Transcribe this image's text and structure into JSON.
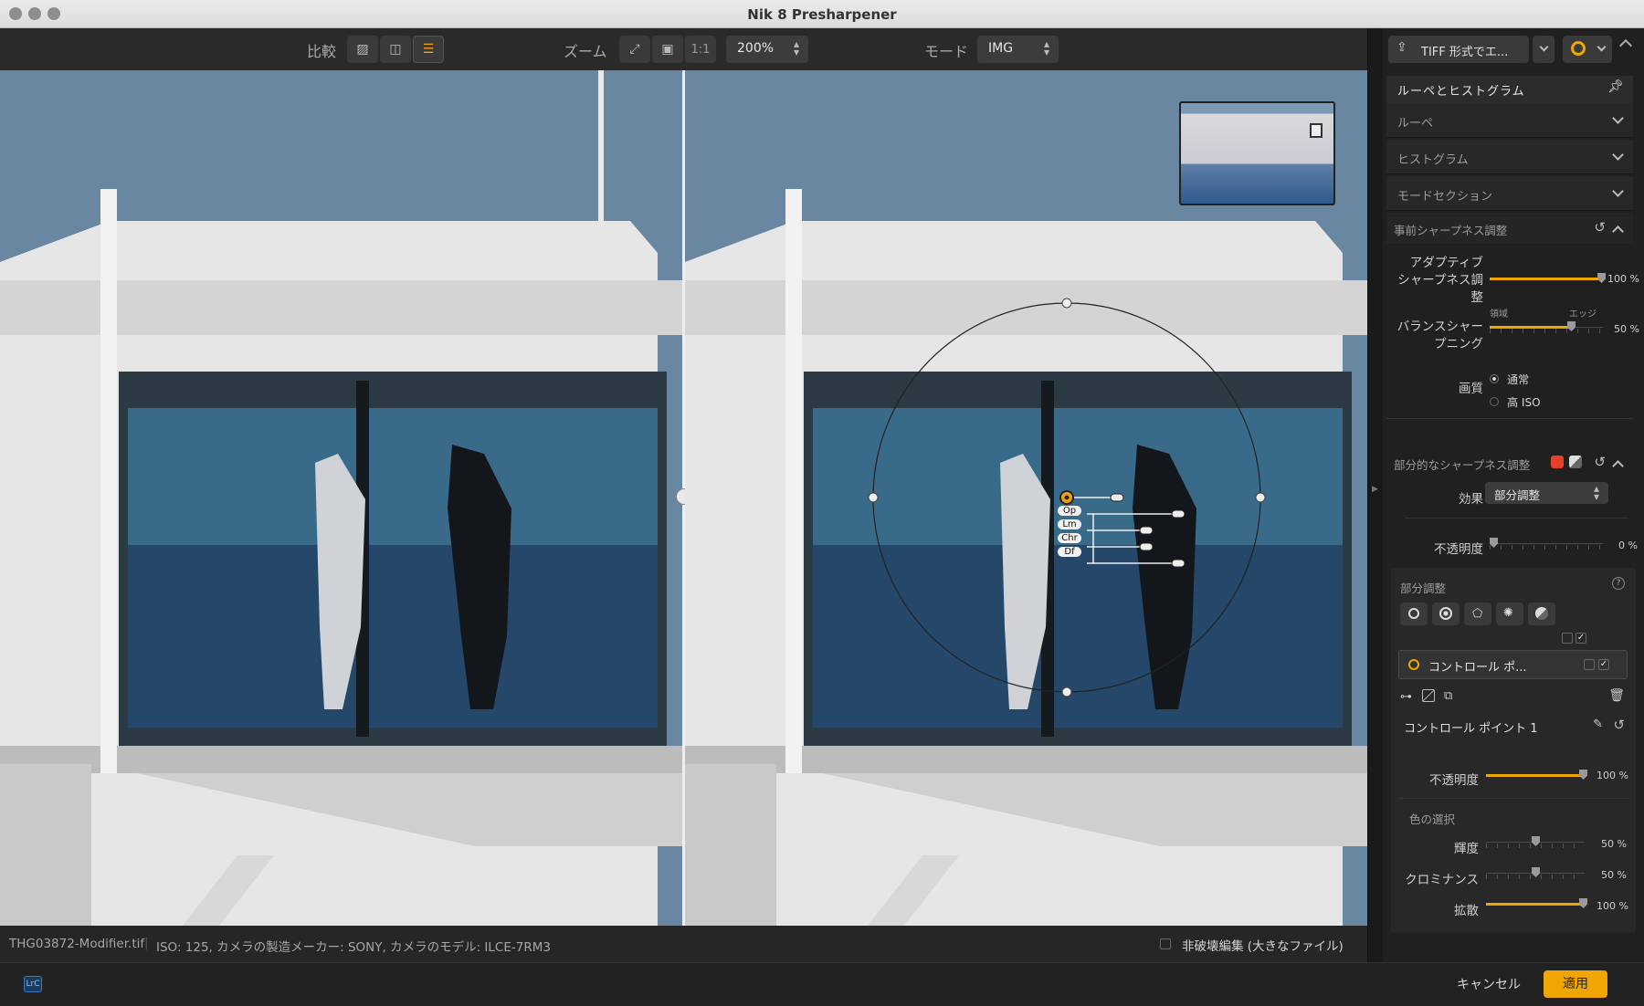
{
  "window": {
    "title": "Nik 8 Presharpener"
  },
  "toolbar": {
    "compare_label": "比較",
    "zoom_label": "ズーム",
    "zoom_one_to_one": "1:1",
    "zoom_value": "200%",
    "mode_label": "モード",
    "mode_value": "IMG"
  },
  "control_point": {
    "labels": [
      "Op",
      "Lm",
      "Chr",
      "Df"
    ]
  },
  "statusbar": {
    "filename": "THG03872-Modifier.tif",
    "metadata": "ISO: 125, カメラの製造メーカー: SONY, カメラのモデル: ILCE-7RM3",
    "non_destructive_label": "非破壊編集 (大きなファイル)"
  },
  "footer": {
    "lrc_badge": "LrC",
    "cancel_label": "キャンセル",
    "apply_label": "適用"
  },
  "panel": {
    "export_label": "TIFF 形式でエ...",
    "loupe_header": "ルーペとヒストグラム",
    "sections": [
      "ルーペ",
      "ヒストグラム",
      "モードセクション"
    ],
    "presharp_title": "事前シャープネス調整",
    "adaptive_label_1": "アダプティブ",
    "adaptive_label_2": "シャープネス調",
    "adaptive_label_3": "整",
    "adaptive_value": "100 %",
    "balance_label_1": "バランスシャー",
    "balance_label_2": "プニング",
    "balance_left": "領域",
    "balance_right": "エッジ",
    "balance_value": "50 %",
    "quality_label": "画質",
    "quality_options": [
      "通常",
      "高 ISO"
    ],
    "partial_title": "部分的なシャープネス調整",
    "effect_label": "効果",
    "effect_value": "部分調整",
    "opacity_label": "不透明度",
    "opacity_value": "0 %",
    "local_title": "部分調整",
    "cp_item_label": "コントロール ポ...",
    "cp_name": "コントロール ポイント 1",
    "cp_opacity_label": "不透明度",
    "cp_opacity_value": "100 %",
    "color_select_label": "色の選択",
    "luminance_label": "輝度",
    "luminance_value": "50 %",
    "chrominance_label": "クロミナンス",
    "chrominance_value": "50 %",
    "diffusion_label": "拡散",
    "diffusion_value": "100 %"
  }
}
